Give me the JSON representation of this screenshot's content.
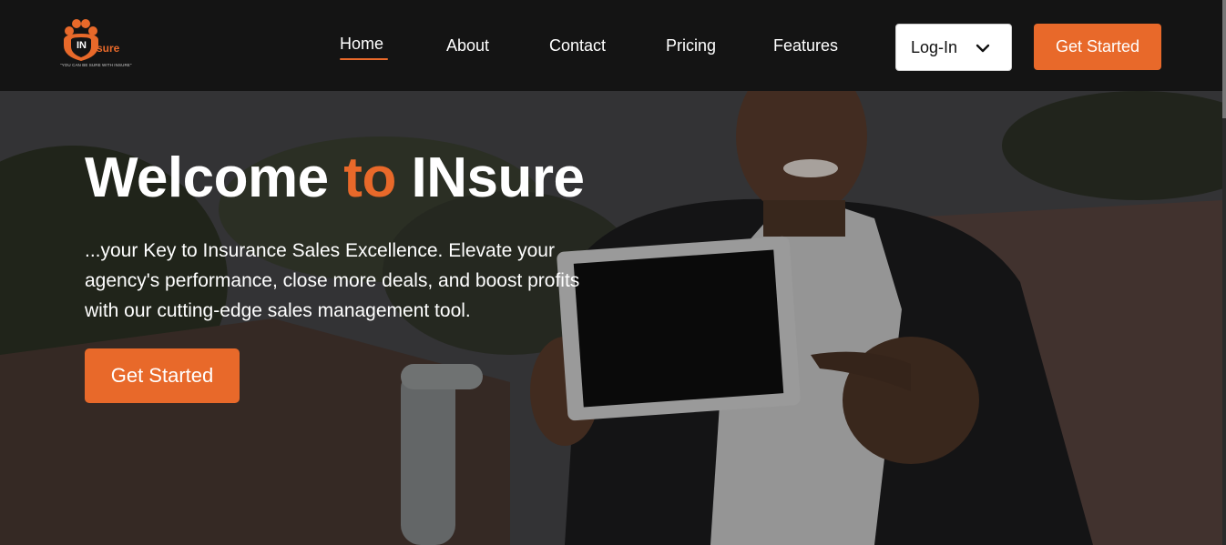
{
  "brand": {
    "logo_in": "IN",
    "logo_sure": "sure",
    "tagline": "\"YOU CAN BE SURE WITH INSURE\"",
    "accent_color": "#e8692a"
  },
  "nav": {
    "items": [
      {
        "label": "Home",
        "active": true
      },
      {
        "label": "About"
      },
      {
        "label": "Contact"
      },
      {
        "label": "Pricing"
      },
      {
        "label": "Features"
      }
    ],
    "login_label": "Log-In",
    "cta_label": "Get Started"
  },
  "hero": {
    "title_part1": "Welcome ",
    "title_accent": "to",
    "title_part2": " INsure",
    "subtitle": "...your Key to Insurance Sales Excellence. Elevate your agency's performance, close more deals, and boost profits with our cutting-edge sales management tool.",
    "cta_label": "Get Started"
  },
  "icons": {
    "login_chevron": "chevron-down-icon",
    "logo_mark": "paw-shield-icon"
  }
}
